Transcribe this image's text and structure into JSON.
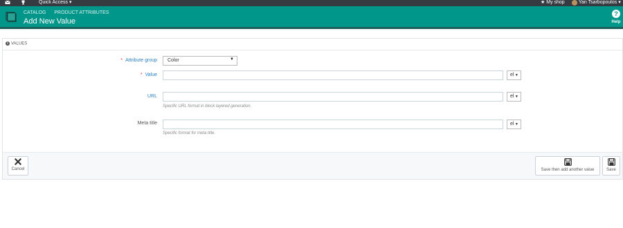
{
  "topbar": {
    "quick_access": "Quick Access",
    "my_shop": "My shop",
    "user": "Yan Tsarbopoulos"
  },
  "header": {
    "breadcrumb": [
      "CATALOG",
      "PRODUCT ATTRIBUTES"
    ],
    "title": "Add New Value",
    "help_label": "Help",
    "help_glyph": "?"
  },
  "panel": {
    "heading": "VALUES",
    "fields": {
      "attribute_group": {
        "label": "Attribute group",
        "required": "*",
        "value": "Color"
      },
      "value": {
        "label": "Value",
        "required": "*",
        "value": "",
        "lang": "el"
      },
      "url": {
        "label": "URL",
        "value": "",
        "lang": "el",
        "help": "Specific URL format in block layered generation."
      },
      "meta_title": {
        "label": "Meta title",
        "value": "",
        "lang": "el",
        "help": "Specific format for meta title."
      }
    }
  },
  "footer": {
    "cancel": "Cancel",
    "save_another": "Save then add another value",
    "save": "Save"
  },
  "colors": {
    "header_bg": "#00968a",
    "topbar_bg": "#363a41",
    "required": "#e0413f",
    "label_link": "#2a7fc0"
  },
  "icons": [
    "envelope-icon",
    "trophy-icon",
    "star-icon",
    "help-icon",
    "info-icon",
    "close-icon",
    "save-icon"
  ]
}
